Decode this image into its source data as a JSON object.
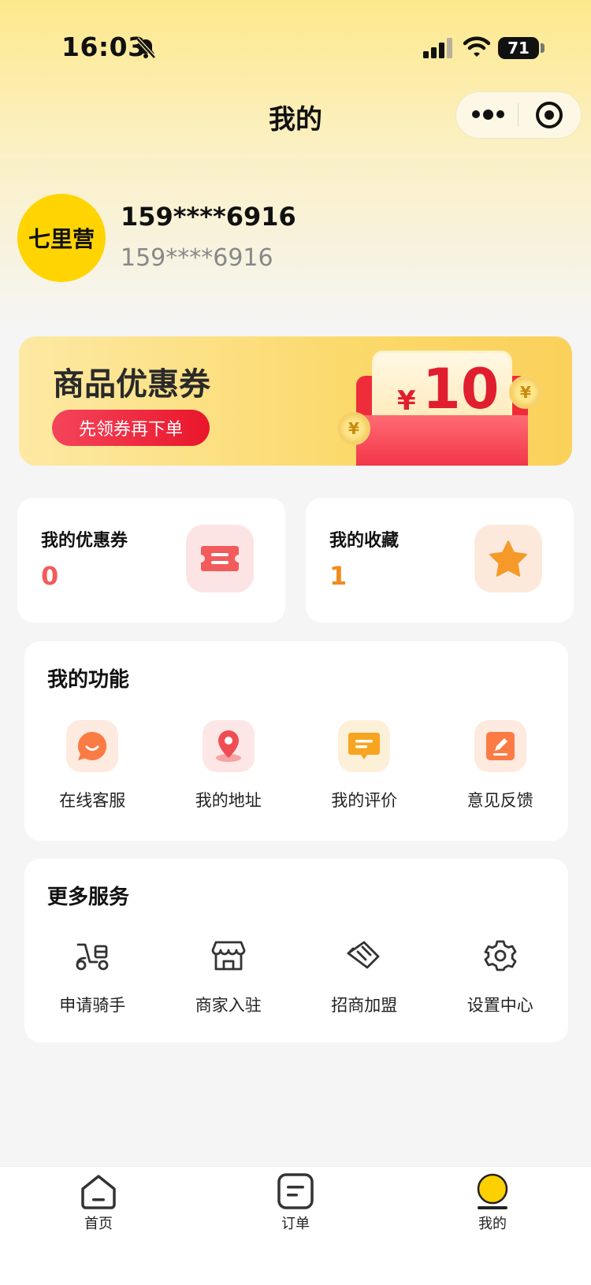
{
  "status_bar": {
    "time": "16:03",
    "battery": "71",
    "icons": [
      "bell-slash-icon",
      "signal-icon",
      "wifi-icon",
      "battery-icon"
    ]
  },
  "nav": {
    "title": "我的",
    "capsule_icons": [
      "more-dots-icon",
      "target-icon"
    ]
  },
  "profile": {
    "avatar_text": "七里营",
    "name": "159****6916",
    "subtitle": "159****6916"
  },
  "banner": {
    "title": "商品优惠券",
    "button": "先领券再下单",
    "currency": "¥",
    "amount": "10",
    "coin_symbol": "¥"
  },
  "stats": [
    {
      "label": "我的优惠券",
      "value": "0",
      "icon": "ticket-icon",
      "color": "#f25b5b"
    },
    {
      "label": "我的收藏",
      "value": "1",
      "icon": "star-icon",
      "color": "#f28a1e"
    }
  ],
  "functions": {
    "title": "我的功能",
    "items": [
      {
        "label": "在线客服",
        "icon": "chat-bubble-icon"
      },
      {
        "label": "我的地址",
        "icon": "location-pin-icon"
      },
      {
        "label": "我的评价",
        "icon": "comment-icon"
      },
      {
        "label": "意见反馈",
        "icon": "edit-icon"
      }
    ]
  },
  "services": {
    "title": "更多服务",
    "items": [
      {
        "label": "申请骑手",
        "icon": "scooter-icon"
      },
      {
        "label": "商家入驻",
        "icon": "store-icon"
      },
      {
        "label": "招商加盟",
        "icon": "handshake-icon"
      },
      {
        "label": "设置中心",
        "icon": "gear-icon"
      }
    ]
  },
  "tabbar": {
    "items": [
      {
        "label": "首页",
        "icon": "home-icon"
      },
      {
        "label": "订单",
        "icon": "order-icon"
      },
      {
        "label": "我的",
        "icon": "profile-icon",
        "active": true
      }
    ]
  }
}
